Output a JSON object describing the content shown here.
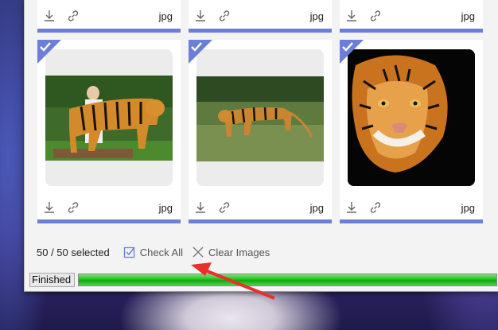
{
  "tiles_top": [
    {
      "ext": "jpg"
    },
    {
      "ext": "jpg"
    },
    {
      "ext": "jpg"
    }
  ],
  "tiles": [
    {
      "ext": "jpg",
      "checked": true,
      "image": "tiger-with-man-photo"
    },
    {
      "ext": "jpg",
      "checked": true,
      "image": "tiger-walking-grass-photo"
    },
    {
      "ext": "jpg",
      "checked": true,
      "image": "tiger-face-portrait-photo"
    }
  ],
  "footer": {
    "count": "50 / 50 selected",
    "check_all": "Check All",
    "clear_images": "Clear Images"
  },
  "status": {
    "label": "Finished",
    "progress": 1.0
  },
  "colors": {
    "accent": "#6c7fd6",
    "progress": "#1fc21a",
    "arrow": "#e8312b"
  }
}
